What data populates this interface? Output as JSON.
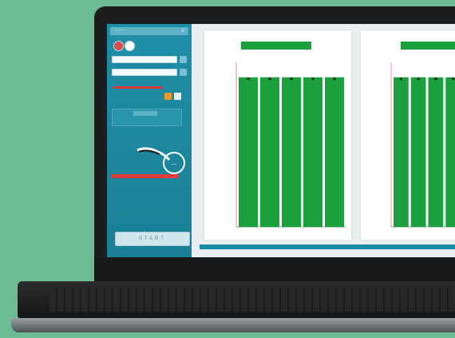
{
  "sidebar": {
    "top_title": "— —",
    "select_1": "",
    "select_2": "",
    "dial_text": "—",
    "start_label": "START"
  },
  "panels": [
    {
      "header": "",
      "legend": "",
      "accent": "#e04a4a",
      "bar_color": "#1aa13d"
    },
    {
      "header": "",
      "legend": "",
      "accent": "#2a6fd6",
      "bar_color": "#1aa13d"
    }
  ],
  "chart_data": [
    {
      "type": "bar",
      "categories": [
        "",
        "",
        "",
        "",
        ""
      ],
      "values": [
        1,
        1,
        1,
        1,
        1
      ],
      "ylim": [
        0,
        1.1
      ],
      "title": "",
      "xlabel": "",
      "ylabel": ""
    },
    {
      "type": "bar",
      "categories": [
        "",
        "",
        "",
        ""
      ],
      "values": [
        1,
        1,
        1,
        1
      ],
      "ylim": [
        0,
        1.1
      ],
      "title": "",
      "xlabel": "",
      "ylabel": ""
    }
  ]
}
